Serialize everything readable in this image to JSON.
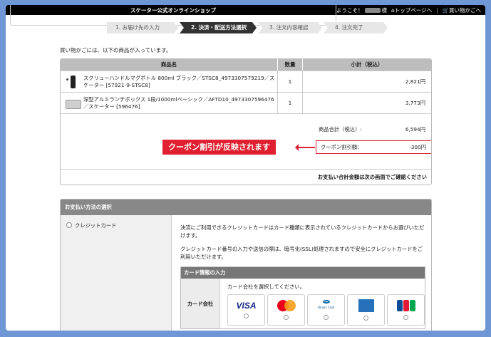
{
  "header": {
    "brand": "スケーター公式オンラインショップ",
    "welcome": "ようこそ！",
    "honorific": "様",
    "top_link": "トップページへ",
    "separator": "|",
    "cart_link": "買い物かごへ"
  },
  "steps": [
    {
      "label": "1. お届け先の入力",
      "active": false
    },
    {
      "label": "2. 決済・配送方法選択",
      "active": true
    },
    {
      "label": "3. 注文内容確認",
      "active": false
    },
    {
      "label": "4. 注文完了",
      "active": false
    }
  ],
  "intro": "買い物かごには、以下の商品が入っています。",
  "cart": {
    "headers": {
      "name": "商品名",
      "qty": "数量",
      "subtotal": "小計（税込）"
    },
    "items": [
      {
        "name": "スクリューハンドルマグボトル 800ml ブラック／STSC8_4973307579219／スケーター [57921-9-STSC8]",
        "qty": "1",
        "subtotal": "2,821円"
      },
      {
        "name": "深型アルミランチボックス 1段/1000mlベーシック／AFTD10_4973307596476／スケーター [596476]",
        "qty": "1",
        "subtotal": "3,773円"
      }
    ],
    "total_label": "商品合計（税込）:",
    "total_value": "6,594円",
    "coupon_label": "クーポン割引額：",
    "coupon_value": "-300円",
    "callout": "クーポン割引が反映されます",
    "confirm_note": "お支払い合計金額は次の画面でご確認ください"
  },
  "payment": {
    "section_title": "お支払い方法の選択",
    "method": "クレジットカード",
    "desc1": "決済にご利用できるクレジットカードはカード種類に表示されているクレジットカードからお選びいただけます。",
    "desc2": "クレジットカード番号の入力や送信の際は、暗号化(SSL)処理されますので安全にクレジットカードをご利用いただけます。",
    "card_info_title": "カード情報の入力",
    "card_company_label": "カード会社",
    "card_company_prompt": "カード会社を選択してください。",
    "brands": [
      "VISA",
      "Mastercard",
      "Diners Club",
      "American Express",
      "JCB"
    ],
    "diners_text": "Diners Club",
    "visa_text": "VISA"
  },
  "colors": {
    "accent_red": "#e02030",
    "background": "#6f97d6"
  }
}
